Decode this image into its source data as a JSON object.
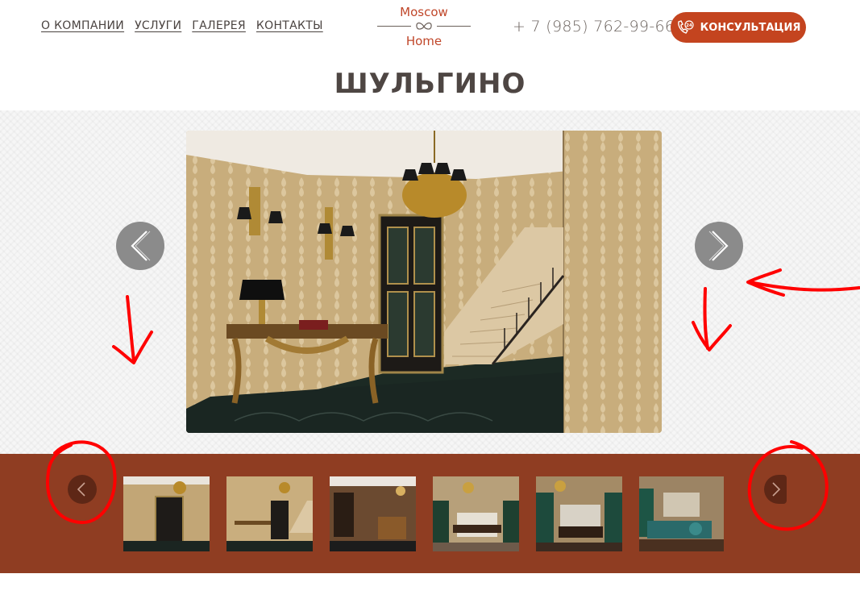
{
  "header": {
    "nav": [
      {
        "label": "О КОМПАНИИ"
      },
      {
        "label": "УСЛУГИ"
      },
      {
        "label": "ГАЛЕРЕЯ"
      },
      {
        "label": "КОНТАКТЫ"
      }
    ],
    "logo": {
      "line1": "Moscow",
      "line2": "Home"
    },
    "phone": "+ 7 (985) 762-99-66",
    "consult_button": "КОНСУЛЬТАЦИЯ",
    "consult_icon_badge": "24"
  },
  "page_title": "ШУЛЬГИНО",
  "colors": {
    "brand": "#c4441f",
    "strip": "#8f3d22",
    "annotation": "#ff0000"
  },
  "gallery": {
    "thumbnails_count": 6,
    "annotations": [
      "arrow-left-to-next-button",
      "down-arrow-left",
      "down-arrow-right",
      "circle-thumb-prev",
      "circle-thumb-next"
    ]
  }
}
